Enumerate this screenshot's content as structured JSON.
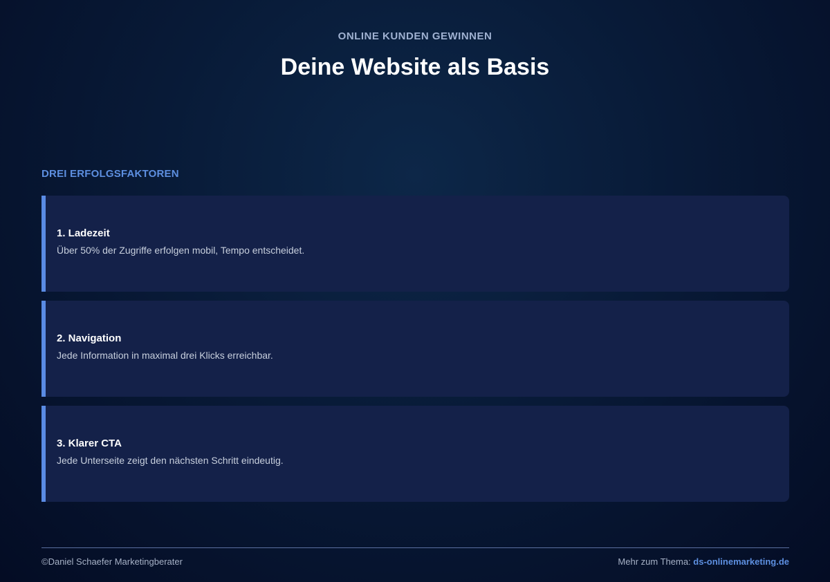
{
  "header": {
    "eyebrow": "ONLINE KUNDEN GEWINNEN",
    "title": "Deine Website als Basis"
  },
  "section": {
    "label": "DREI ERFOLGSFAKTOREN",
    "items": [
      {
        "title": "1. Ladezeit",
        "text": "Über 50% der Zugriffe erfolgen mobil, Tempo entscheidet."
      },
      {
        "title": "2. Navigation",
        "text": "Jede Information in maximal drei Klicks erreichbar."
      },
      {
        "title": "3. Klarer CTA",
        "text": "Jede Unterseite zeigt den nächsten Schritt eindeutig."
      }
    ]
  },
  "footer": {
    "copyright": "©Daniel Schaefer Marketingberater",
    "more_label": "Mehr zum Thema:",
    "link_text": "ds-onlinemarketing.de"
  },
  "colors": {
    "accent": "#5a8be4",
    "card_bg": "#142149",
    "background": "#081a37"
  }
}
